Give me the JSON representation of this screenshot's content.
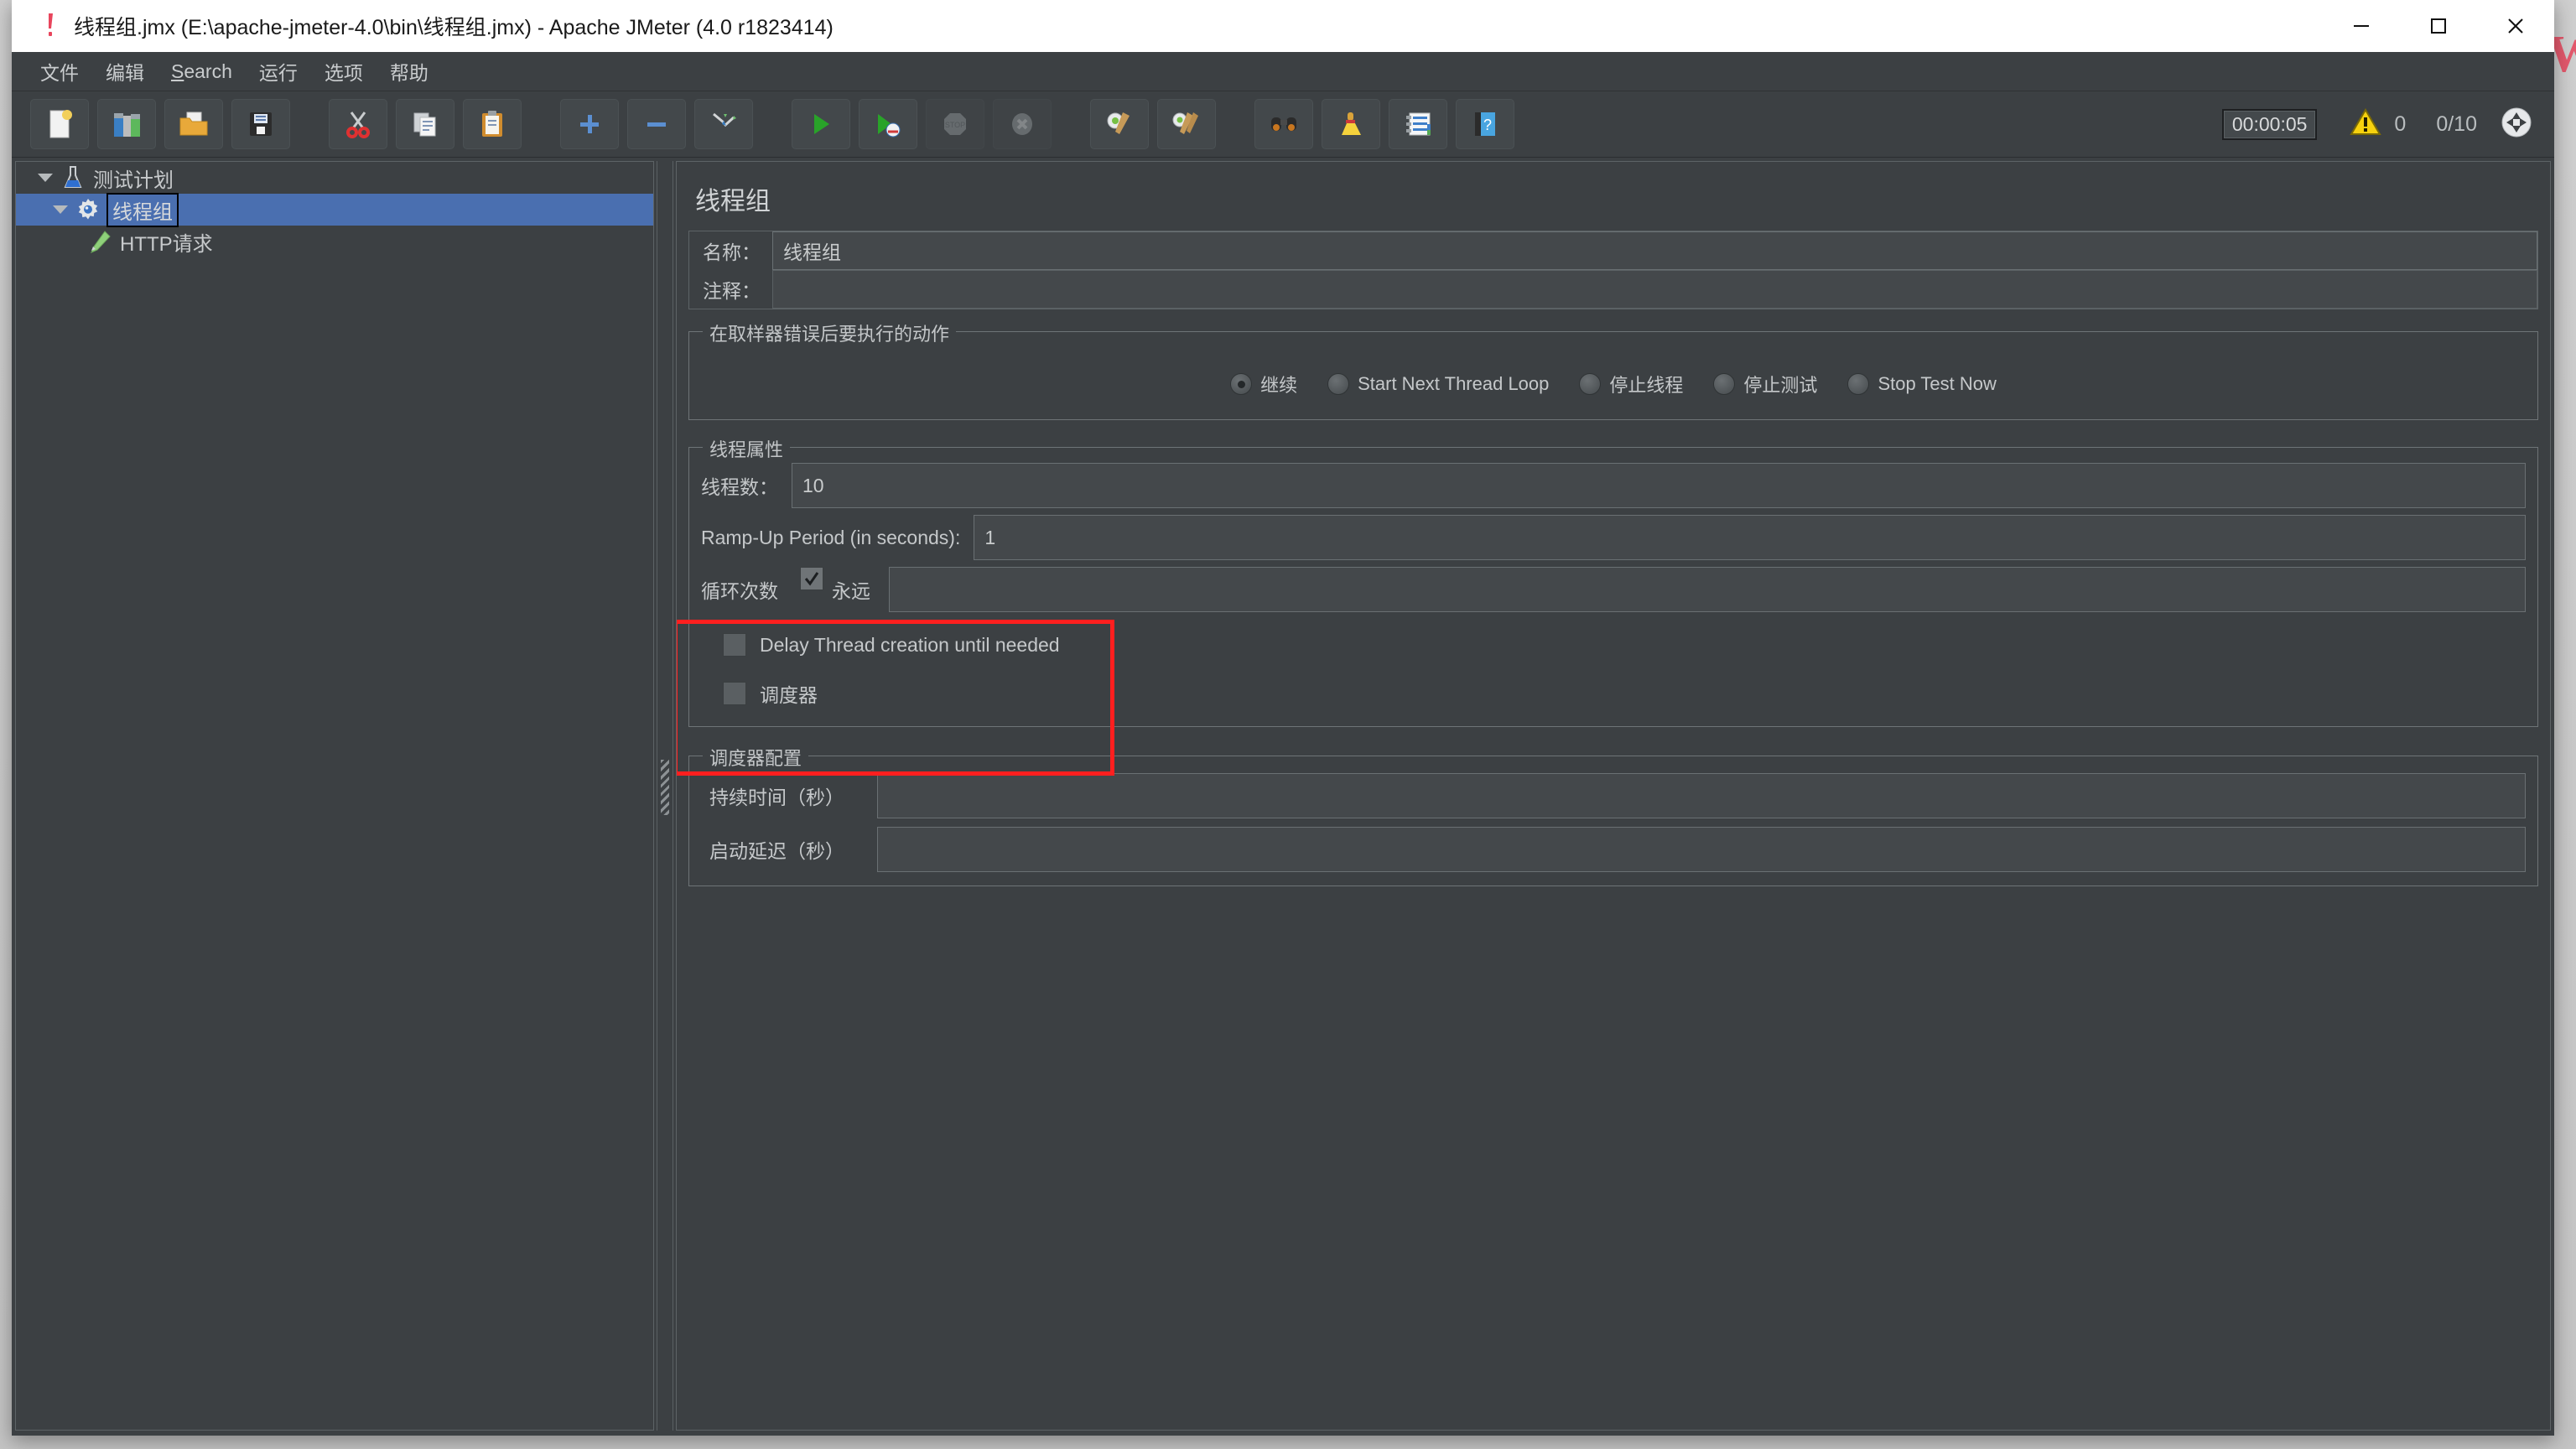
{
  "window": {
    "title": "线程组.jmx (E:\\apache-jmeter-4.0\\bin\\线程组.jmx) - Apache JMeter (4.0 r1823414)",
    "minimize_label": "minimize",
    "maximize_label": "maximize",
    "close_label": "close"
  },
  "desktop": {
    "watermark": "W"
  },
  "menubar": {
    "items": [
      {
        "label": "文件",
        "name": "menu-file"
      },
      {
        "label": "编辑",
        "name": "menu-edit"
      },
      {
        "label": "Search",
        "name": "menu-search",
        "mnemonic": "S"
      },
      {
        "label": "运行",
        "name": "menu-run"
      },
      {
        "label": "选项",
        "name": "menu-options"
      },
      {
        "label": "帮助",
        "name": "menu-help"
      }
    ]
  },
  "toolbar": {
    "buttons": [
      {
        "icon": "new-document-icon",
        "name": "new-test-plan-button",
        "enabled": true
      },
      {
        "icon": "templates-icon",
        "name": "templates-button",
        "enabled": true
      },
      {
        "icon": "open-folder-icon",
        "name": "open-button",
        "enabled": true
      },
      {
        "icon": "save-floppy-icon",
        "name": "save-button",
        "enabled": true
      },
      {
        "icon": "scissors-icon",
        "name": "cut-button",
        "enabled": true
      },
      {
        "icon": "copy-pages-icon",
        "name": "copy-button",
        "enabled": true
      },
      {
        "icon": "clipboard-icon",
        "name": "paste-button",
        "enabled": true
      },
      {
        "icon": "plus-icon",
        "name": "expand-all-button",
        "enabled": true
      },
      {
        "icon": "minus-icon",
        "name": "collapse-all-button",
        "enabled": true
      },
      {
        "icon": "toggle-icon",
        "name": "toggle-button",
        "enabled": true
      },
      {
        "icon": "play-green-icon",
        "name": "start-button",
        "enabled": true
      },
      {
        "icon": "play-remote-icon",
        "name": "start-no-pause-button",
        "enabled": true
      },
      {
        "icon": "stop-octagon-icon",
        "name": "stop-button",
        "enabled": false
      },
      {
        "icon": "shutdown-x-icon",
        "name": "shutdown-button",
        "enabled": false
      },
      {
        "icon": "gear-broom-icon",
        "name": "clear-button",
        "enabled": true
      },
      {
        "icon": "gear-brooms-icon",
        "name": "clear-all-button",
        "enabled": true
      },
      {
        "icon": "binoculars-icon",
        "name": "search-button",
        "enabled": true
      },
      {
        "icon": "yellow-broom-icon",
        "name": "reset-search-button",
        "enabled": true
      },
      {
        "icon": "function-helper-icon",
        "name": "function-helper-button",
        "enabled": true
      },
      {
        "icon": "help-book-icon",
        "name": "help-button",
        "enabled": true
      }
    ],
    "timer": "00:00:05",
    "warning_count": "0",
    "thread_count": "0/10",
    "status_icon": "connection-status-icon"
  },
  "tree": {
    "nodes": [
      {
        "label": "测试计划",
        "icon": "test-plan-flask-icon",
        "expanded": true,
        "selected": false,
        "depth": 0,
        "name": "tree-node-test-plan"
      },
      {
        "label": "线程组",
        "icon": "thread-group-gear-icon",
        "expanded": true,
        "selected": true,
        "depth": 1,
        "name": "tree-node-thread-group"
      },
      {
        "label": "HTTP请求",
        "icon": "http-request-pen-icon",
        "expanded": false,
        "selected": false,
        "depth": 2,
        "name": "tree-node-http-request"
      }
    ]
  },
  "panel": {
    "title": "线程组",
    "name_label": "名称：",
    "name_value": "线程组",
    "comment_label": "注释：",
    "comment_value": "",
    "error_action": {
      "group_title": "在取样器错误后要执行的动作",
      "options": [
        {
          "label": "继续",
          "selected": true,
          "name": "radio-continue"
        },
        {
          "label": "Start Next Thread Loop",
          "selected": false,
          "name": "radio-start-next-thread-loop"
        },
        {
          "label": "停止线程",
          "selected": false,
          "name": "radio-stop-thread"
        },
        {
          "label": "停止测试",
          "selected": false,
          "name": "radio-stop-test"
        },
        {
          "label": "Stop Test Now",
          "selected": false,
          "name": "radio-stop-test-now"
        }
      ]
    },
    "thread_properties": {
      "group_title": "线程属性",
      "num_threads_label": "线程数：",
      "num_threads_value": "10",
      "ramp_up_label": "Ramp-Up Period (in seconds):",
      "ramp_up_value": "1",
      "loop_count_label": "循环次数",
      "forever_label": "永远",
      "forever_checked": true,
      "loop_count_value": "",
      "delay_thread_label": "Delay Thread creation until needed",
      "delay_thread_checked": false,
      "scheduler_label": "调度器",
      "scheduler_checked": false
    },
    "scheduler_config": {
      "group_title": "调度器配置",
      "duration_label": "持续时间（秒）",
      "duration_value": "",
      "startup_delay_label": "启动延迟（秒）",
      "startup_delay_value": ""
    }
  },
  "annotation": {
    "color": "#ff1f1f",
    "shape": "rectangle",
    "target": "thread-properties-fields"
  }
}
